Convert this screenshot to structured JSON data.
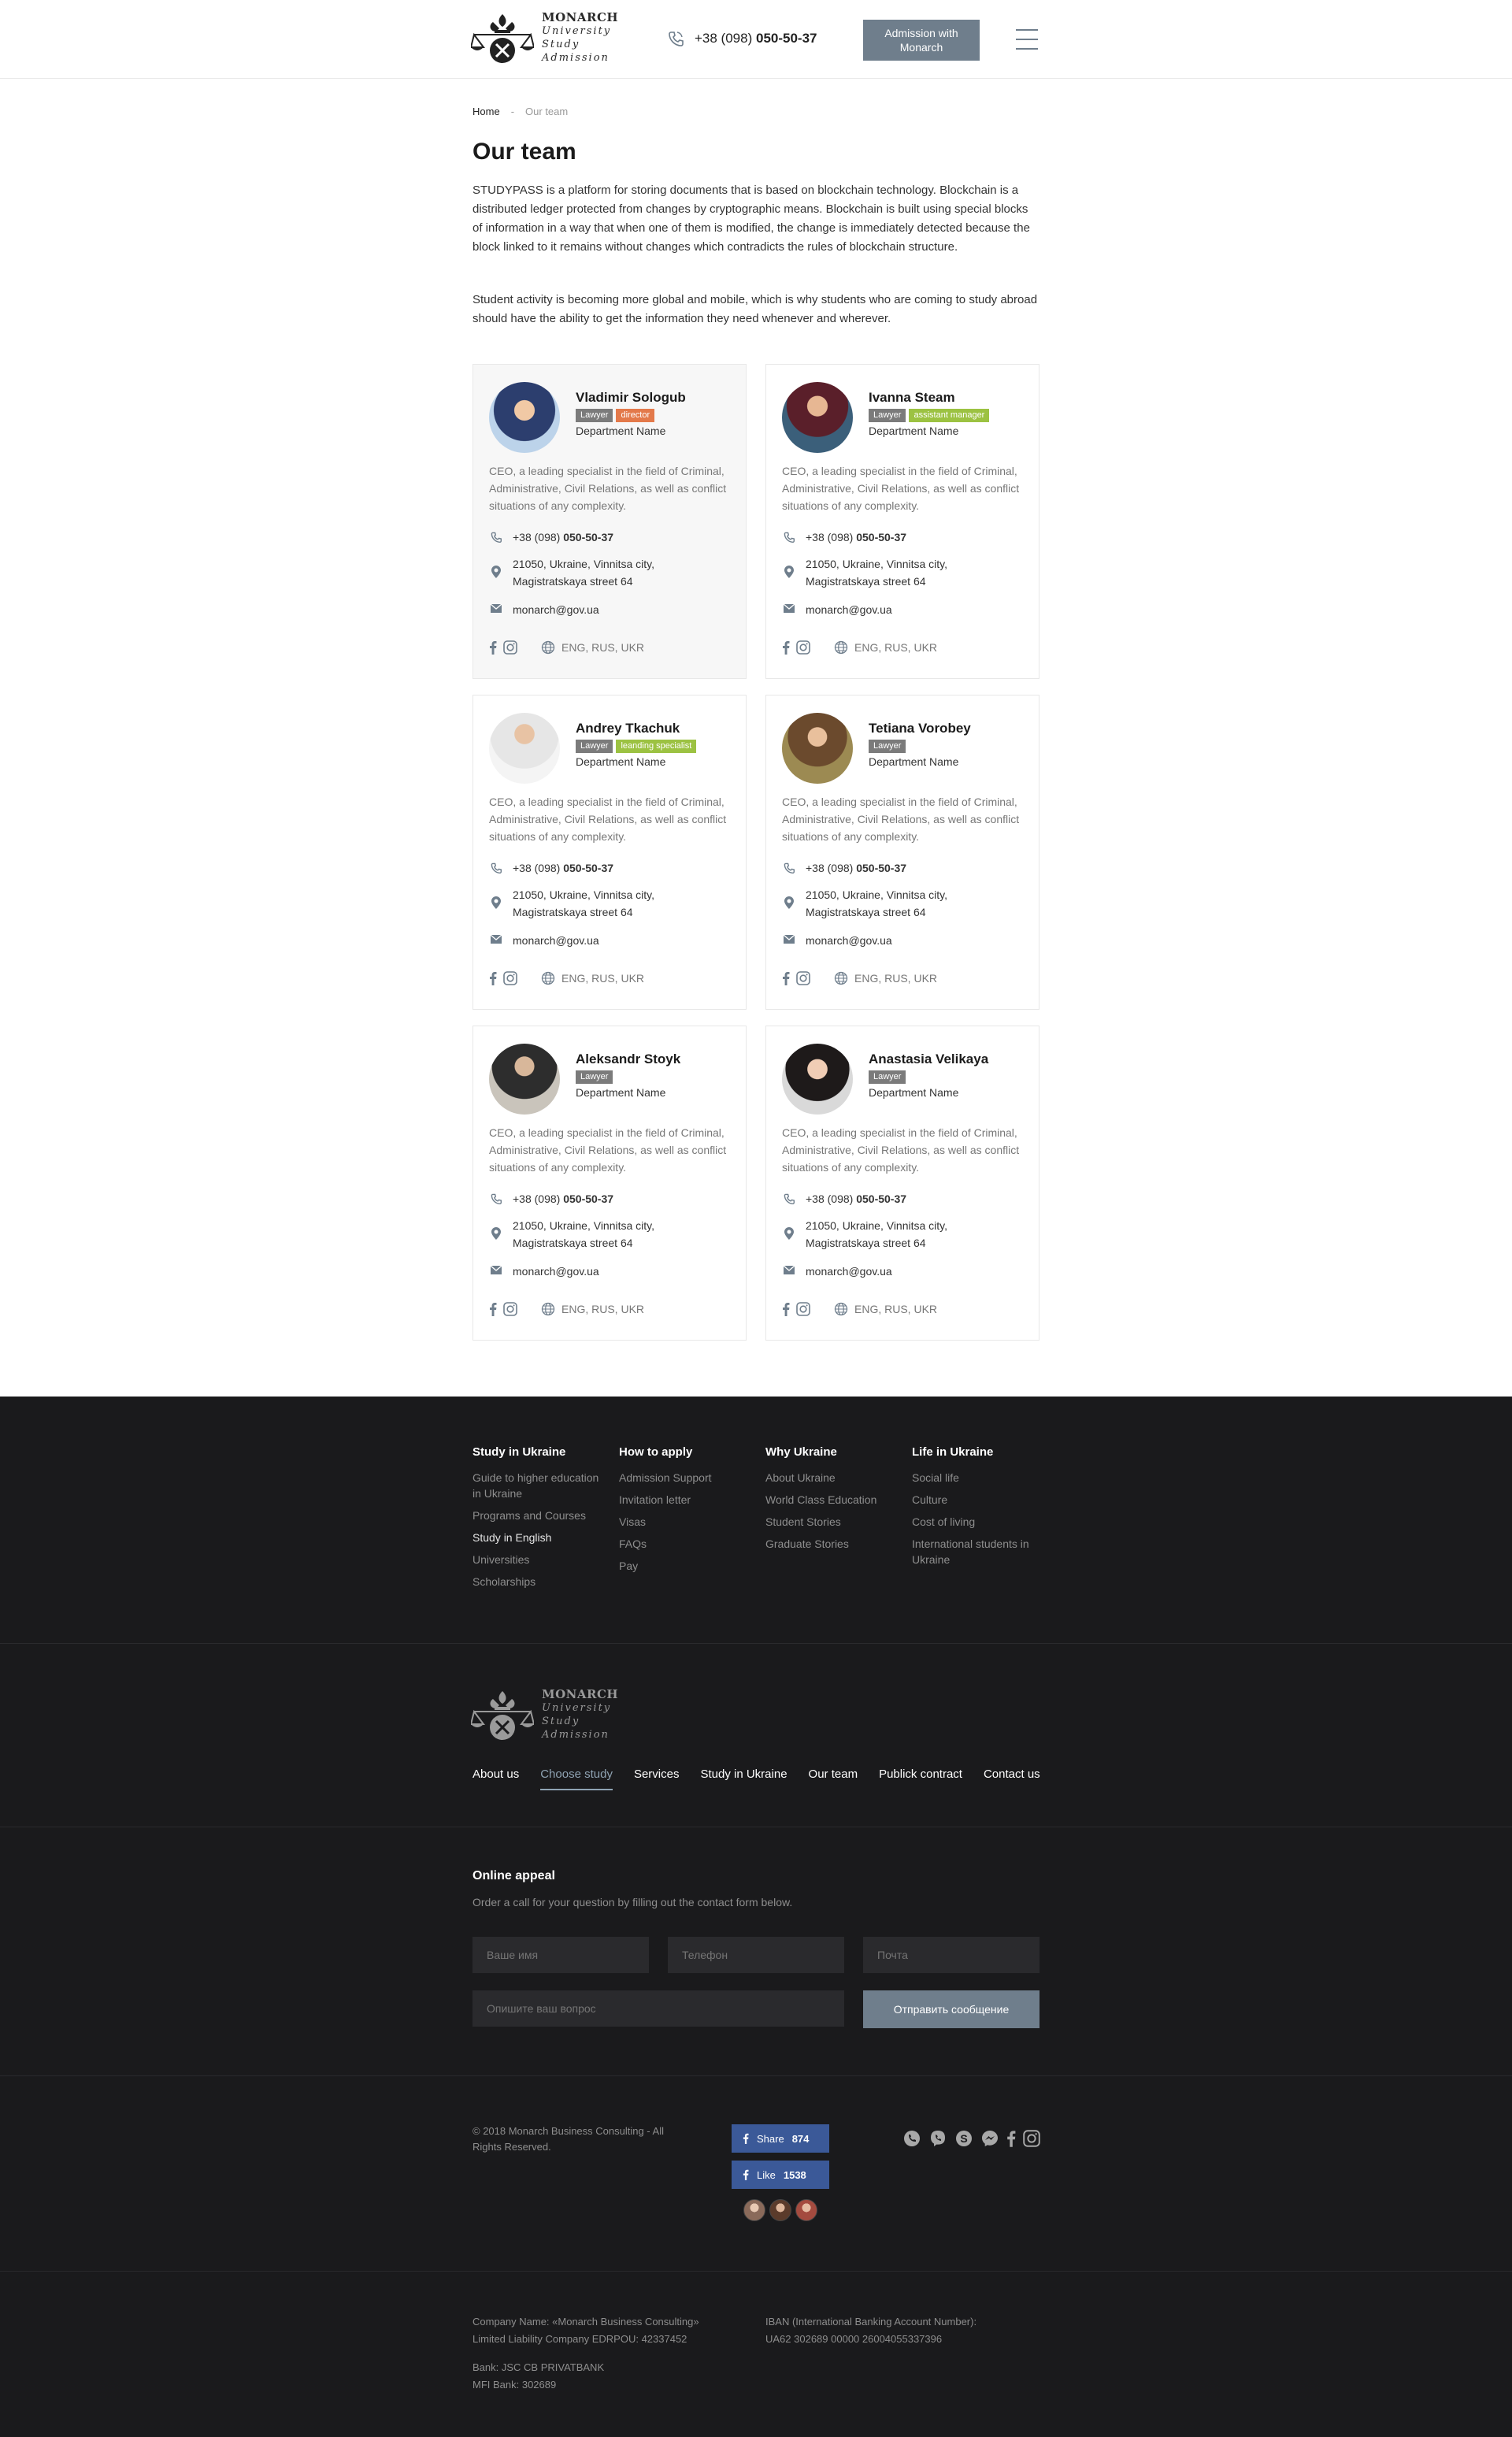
{
  "header": {
    "logo": {
      "brand": "MONARCH",
      "line1": "University",
      "line2": "Study",
      "line3": "Admission"
    },
    "phone_prefix": "+38 (098)",
    "phone_number": "050-50-37",
    "admission_button": "Admission with Monarch"
  },
  "breadcrumb": {
    "home": "Home",
    "separator": "-",
    "current": "Our team"
  },
  "page_title": "Our team",
  "intro": [
    "STUDYPASS is a platform for storing documents that is based on blockchain technology. Blockchain is a distributed ledger protected from changes by cryptographic means. Blockchain is built using special blocks of information in a way that when one of them is modified, the change is immediately detected because the block linked to it remains without changes which contradicts the rules of blockchain structure.",
    "Student activity is becoming more global and mobile, which is why students who are coming to study abroad should have the ability to get the information they need whenever and wherever."
  ],
  "team": [
    {
      "name": "Vladimir Sologub",
      "badges": [
        {
          "label": "Lawyer",
          "color": "#7b7b7b"
        },
        {
          "label": "director",
          "color": "#e3794a"
        }
      ],
      "department": "Department Name",
      "description": "CEO, a leading specialist in the field of Criminal, Administrative, Civil Relations, as well as conflict situations of any complexity.",
      "phone_prefix": "+38 (098)",
      "phone_number": "050-50-37",
      "address_1": "21050, Ukraine, Vinnitsa city,",
      "address_2": "Magistratskaya street 64",
      "email": "monarch@gov.ua",
      "languages": "ENG, RUS, UKR"
    },
    {
      "name": "Ivanna Steam",
      "badges": [
        {
          "label": "Lawyer",
          "color": "#7b7b7b"
        },
        {
          "label": "assistant manager",
          "color": "#9cc242"
        }
      ],
      "department": "Department Name",
      "description": "CEO, a leading specialist in the field of Criminal, Administrative, Civil Relations, as well as conflict situations of any complexity.",
      "phone_prefix": "+38 (098)",
      "phone_number": "050-50-37",
      "address_1": "21050, Ukraine, Vinnitsa city,",
      "address_2": "Magistratskaya street 64",
      "email": "monarch@gov.ua",
      "languages": "ENG, RUS, UKR"
    },
    {
      "name": "Andrey Tkachuk",
      "badges": [
        {
          "label": "Lawyer",
          "color": "#7b7b7b"
        },
        {
          "label": "leanding specialist",
          "color": "#9cc242"
        }
      ],
      "department": "Department Name",
      "description": "CEO, a leading specialist in the field of Criminal, Administrative, Civil Relations, as well as conflict situations of any complexity.",
      "phone_prefix": "+38 (098)",
      "phone_number": "050-50-37",
      "address_1": "21050, Ukraine, Vinnitsa city,",
      "address_2": "Magistratskaya street 64",
      "email": "monarch@gov.ua",
      "languages": "ENG, RUS, UKR"
    },
    {
      "name": "Tetiana Vorobey",
      "badges": [
        {
          "label": "Lawyer",
          "color": "#7b7b7b"
        }
      ],
      "department": "Department Name",
      "description": "CEO, a leading specialist in the field of Criminal, Administrative, Civil Relations, as well as conflict situations of any complexity.",
      "phone_prefix": "+38 (098)",
      "phone_number": "050-50-37",
      "address_1": "21050, Ukraine, Vinnitsa city,",
      "address_2": "Magistratskaya street 64",
      "email": "monarch@gov.ua",
      "languages": "ENG, RUS, UKR"
    },
    {
      "name": "Aleksandr Stoyk",
      "badges": [
        {
          "label": "Lawyer",
          "color": "#7b7b7b"
        }
      ],
      "department": "Department Name",
      "description": "CEO, a leading specialist in the field of Criminal, Administrative, Civil Relations, as well as conflict situations of any complexity.",
      "phone_prefix": "+38 (098)",
      "phone_number": "050-50-37",
      "address_1": "21050, Ukraine, Vinnitsa city,",
      "address_2": "Magistratskaya street 64",
      "email": "monarch@gov.ua",
      "languages": "ENG, RUS, UKR"
    },
    {
      "name": "Anastasia Velikaya",
      "badges": [
        {
          "label": "Lawyer",
          "color": "#7b7b7b"
        }
      ],
      "department": "Department Name",
      "description": "CEO, a leading specialist in the field of Criminal, Administrative, Civil Relations, as well as conflict situations of any complexity.",
      "phone_prefix": "+38 (098)",
      "phone_number": "050-50-37",
      "address_1": "21050, Ukraine, Vinnitsa city,",
      "address_2": "Magistratskaya street 64",
      "email": "monarch@gov.ua",
      "languages": "ENG, RUS, UKR"
    }
  ],
  "footer": {
    "columns": [
      {
        "title": "Study in Ukraine",
        "links": [
          "Guide to higher education in Ukraine",
          "Programs and Courses",
          "Study in English",
          "Universities",
          "Scholarships"
        ],
        "active": "Study in English"
      },
      {
        "title": "How to apply",
        "links": [
          "Admission Support",
          "Invitation letter",
          "Visas",
          "FAQs",
          "Pay"
        ],
        "active": ""
      },
      {
        "title": "Why Ukraine",
        "links": [
          "About Ukraine",
          "World Class Education",
          "Student Stories",
          "Graduate Stories"
        ],
        "active": ""
      },
      {
        "title": "Life in Ukraine",
        "links": [
          "Social life",
          "Culture",
          "Cost of living",
          "International students in Ukraine"
        ],
        "active": ""
      }
    ],
    "nav": [
      "About us",
      "Choose study",
      "Services",
      "Study in Ukraine",
      "Our team",
      "Publick contract",
      "Contact us"
    ],
    "nav_active": "Choose study",
    "appeal_title": "Online appeal",
    "appeal_subtitle": "Order a call for your question by filling out the contact form below.",
    "placeholders": {
      "name": "Ваше имя",
      "phone": "Телефон",
      "email": "Почта",
      "question": "Опишите ваш вопрос"
    },
    "submit_label": "Отправить сообщение",
    "copyright": "© 2018 Monarch Business Consulting - All Rights Reserved.",
    "share_label": "Share",
    "share_count": "874",
    "like_label": "Like",
    "like_count": "1538",
    "company_line1": "Company Name: «Monarch Business Consulting»",
    "company_line2": "Limited Liability Company EDRPOU: 42337452",
    "bank_line1": "Bank: JSC CB PRIVATBANK",
    "bank_line2": "MFI Bank: 302689",
    "iban_line1": "IBAN (International Banking Account Number):",
    "iban_line2": "UA62 302689 00000 26004055337396"
  },
  "colors": {
    "accent": "#6f7e8c",
    "footer_bg": "#1a1a1c",
    "badge_gray": "#7b7b7b",
    "badge_orange": "#e3794a",
    "badge_green": "#9cc242",
    "facebook": "#3b5998"
  }
}
